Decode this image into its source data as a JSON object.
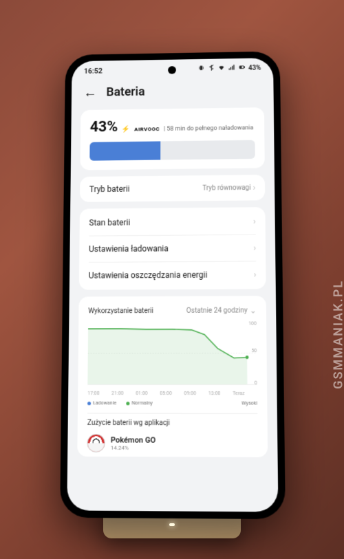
{
  "watermark": "GSMMANIAK.PL",
  "statusbar": {
    "time": "16:52",
    "battery_pct": "43%"
  },
  "header": {
    "title": "Bateria"
  },
  "battery": {
    "percent_label": "43%",
    "charge_tech": "AIRVOOC",
    "eta": "| 58 min do pełnego naładowania",
    "fill_percent": 43
  },
  "mode_row": {
    "label": "Tryb baterii",
    "value": "Tryb równowagi"
  },
  "settings": [
    {
      "label": "Stan baterii"
    },
    {
      "label": "Ustawienia ładowania"
    },
    {
      "label": "Ustawienia oszczędzania energii"
    }
  ],
  "usage": {
    "title": "Wykorzystanie baterii",
    "period": "Ostatnie 24 godziny",
    "legend_charging": "Ładowanie",
    "legend_normal": "Normalny",
    "legend_high": "Wysoki",
    "apps_title": "Zużycie baterii wg aplikacji",
    "app": {
      "name": "Pokémon GO",
      "pct": "14.24%"
    }
  },
  "chart_data": {
    "type": "area",
    "title": "Wykorzystanie baterii",
    "xlabel": "",
    "ylabel": "%",
    "ylim": [
      0,
      100
    ],
    "x_ticks": [
      "17:00",
      "21:00",
      "01:00",
      "05:00",
      "09:00",
      "13:00",
      "Teraz"
    ],
    "y_ticks": [
      0,
      50,
      100
    ],
    "series": [
      {
        "name": "battery_level",
        "x": [
          "17:00",
          "19:00",
          "21:00",
          "23:00",
          "01:00",
          "03:00",
          "05:00",
          "07:00",
          "09:00",
          "11:00",
          "13:00",
          "Teraz"
        ],
        "values": [
          90,
          90,
          89,
          89,
          89,
          89,
          89,
          88,
          80,
          58,
          42,
          43
        ]
      }
    ],
    "current_marker": {
      "x": "Teraz",
      "value": 43
    }
  }
}
